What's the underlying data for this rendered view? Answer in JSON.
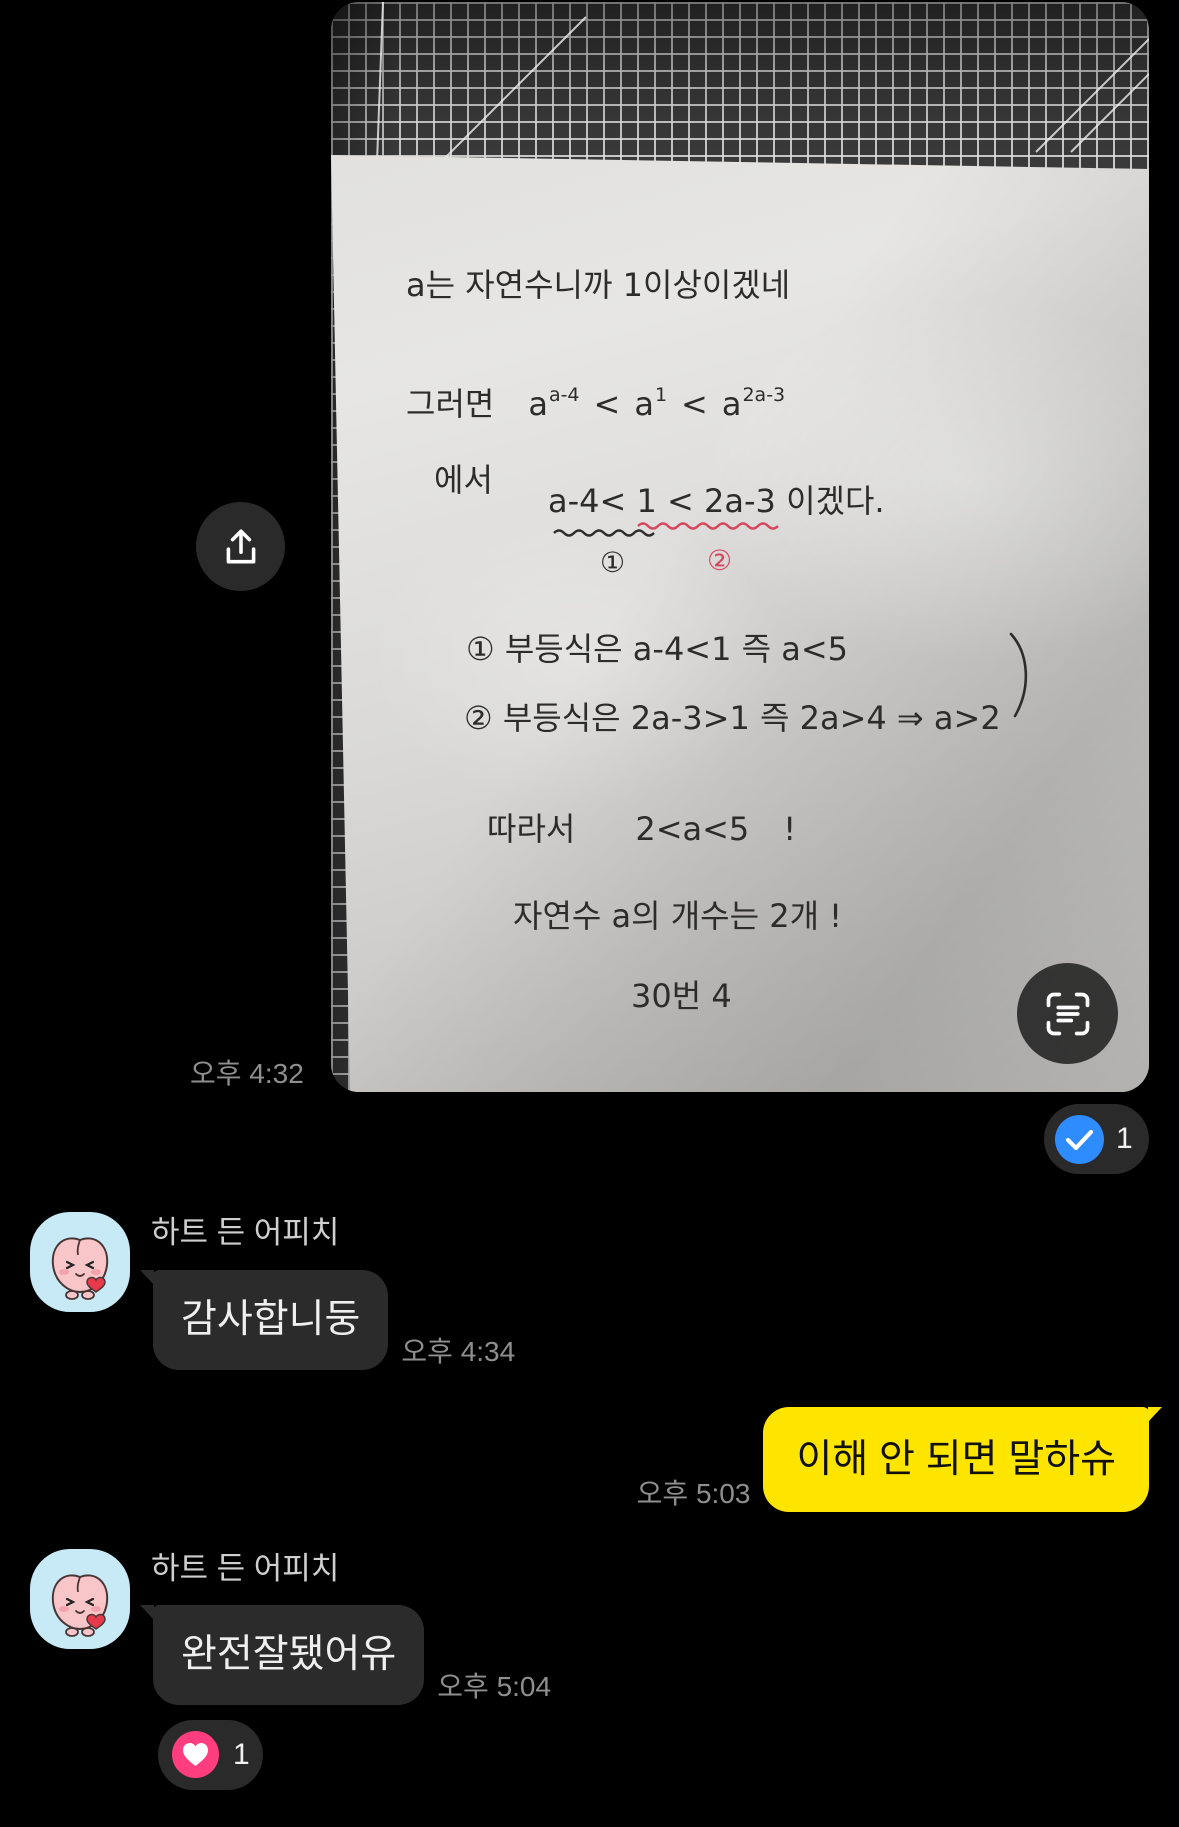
{
  "theme": {
    "background": "#000000",
    "bubble_other": "#2B2B2B",
    "bubble_mine": "#FEE500",
    "check_blue": "#2F8CFF",
    "heart_pink": "#FF3D7F",
    "avatar_bg": "#C7EAF6"
  },
  "photo_message": {
    "time": "오후 4:32",
    "share_icon": "share-icon",
    "scan_icon": "text-scan-icon",
    "reaction": {
      "icon": "check-icon",
      "count": "1"
    },
    "note": {
      "line1": "a는 자연수니까 1이상이겠네",
      "line2": {
        "word": "그러면",
        "terms": [
          {
            "base": "a",
            "exp": "a-4"
          },
          {
            "base": "a",
            "exp": "1"
          },
          {
            "base": "a",
            "exp": "2a-3"
          }
        ],
        "ops": [
          "<",
          "<"
        ]
      },
      "line3": "에서",
      "line4": "a-4< 1 < 2a-3 이겠다.",
      "mark1": "①",
      "mark2": "②",
      "line5": "① 부등식은 a-4<1 즉 a<5",
      "line6": "② 부등식은 2a-3>1 즉 2a>4 ⇒ a>2",
      "line7": {
        "word": "따라서",
        "expr": "2<a<5",
        "bang": "!"
      },
      "line8": "자연수 a의 개수는 2개 !",
      "line9": "30번 4"
    }
  },
  "messages": [
    {
      "sender": "하트 든 어피치",
      "avatar_icon": "apeach-avatar",
      "text": "감사합니둥",
      "time": "오후 4:34"
    },
    {
      "text": "이해 안 되면 말하슈",
      "time": "오후 5:03"
    },
    {
      "sender": "하트 든 어피치",
      "avatar_icon": "apeach-avatar",
      "text": "완전잘됐어유",
      "time": "오후 5:04",
      "reaction": {
        "icon": "heart-icon",
        "count": "1"
      }
    }
  ]
}
